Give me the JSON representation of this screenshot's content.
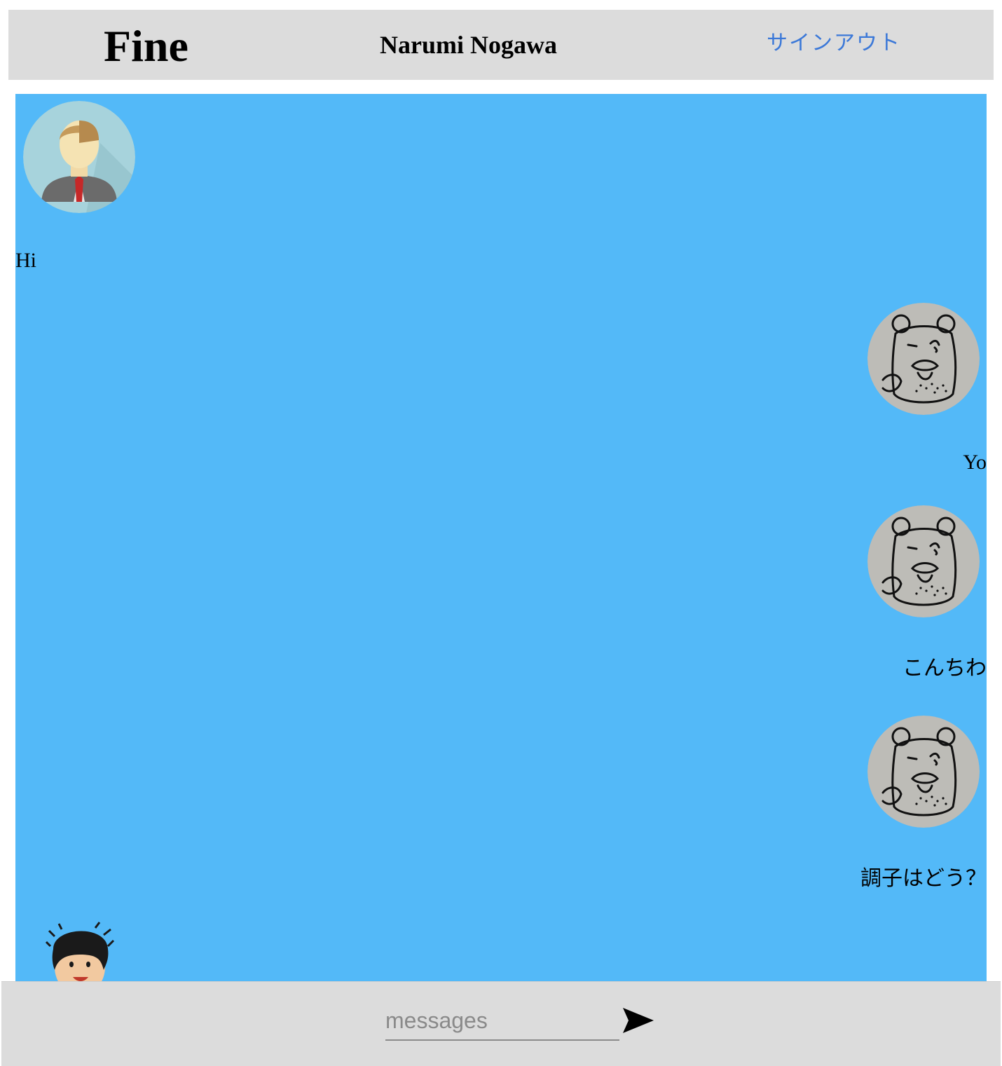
{
  "header": {
    "brand": "Fine",
    "username": "Narumi Nogawa",
    "signout_label": "サインアウト"
  },
  "colors": {
    "header_bg": "#dcdcdc",
    "chat_bg": "#53b9f8",
    "link": "#3b78d8"
  },
  "messages": [
    {
      "side": "left",
      "avatar": "businessman-avatar-icon",
      "text": "Hi"
    },
    {
      "side": "right",
      "avatar": "bear-sketch-avatar-icon",
      "text": "Yo"
    },
    {
      "side": "right",
      "avatar": "bear-sketch-avatar-icon",
      "text": "こんちわ"
    },
    {
      "side": "right",
      "avatar": "bear-sketch-avatar-icon",
      "text": "調子はどう？"
    },
    {
      "side": "left",
      "avatar": "boy-cartoon-avatar-icon",
      "text": ""
    }
  ],
  "composer": {
    "placeholder": "messages",
    "value": "",
    "send_icon": "send-arrow-icon"
  }
}
